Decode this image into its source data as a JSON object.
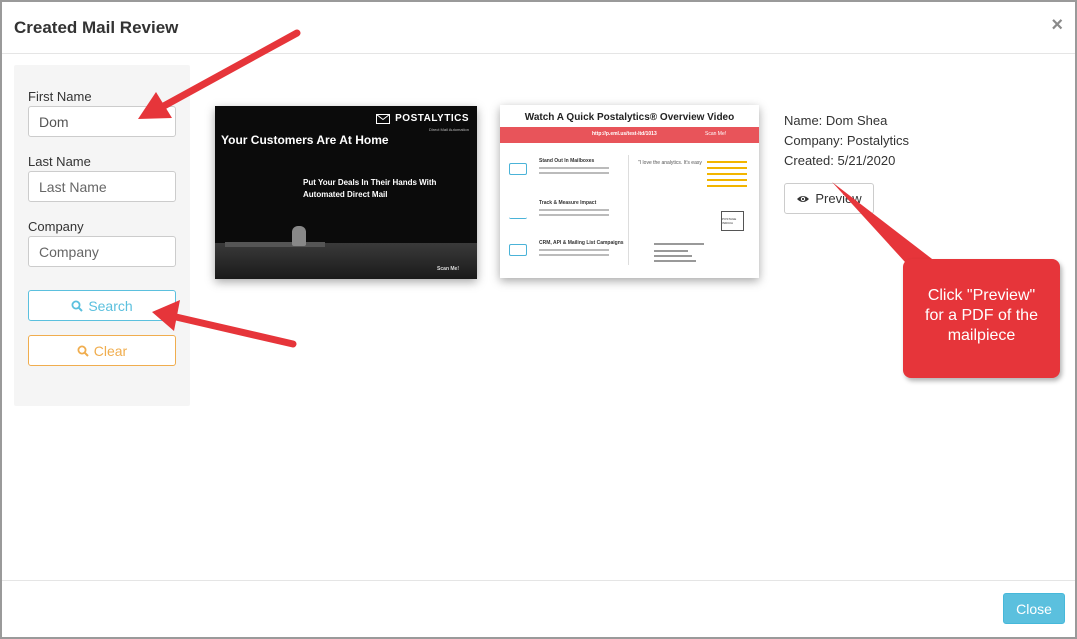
{
  "modal": {
    "title": "Created Mail Review",
    "close_glyph": "×"
  },
  "search": {
    "first_name_label": "First Name",
    "first_name_value": "Dom",
    "last_name_label": "Last Name",
    "last_name_placeholder": "Last Name",
    "company_label": "Company",
    "company_placeholder": "Company",
    "search_button_label": "Search",
    "clear_button_label": "Clear"
  },
  "mailpiece": {
    "front": {
      "brand": "POSTALYTICS",
      "brand_sub": "Direct Mail Automation",
      "headline": "Your Customers Are At Home",
      "sub_line_1": "Put Your Deals In Their Hands With",
      "sub_line_2": "Automated Direct Mail",
      "scan_label": "Scan Me!"
    },
    "back": {
      "title": "Watch A Quick Postalytics® Overview Video",
      "url": "http://p.eml.us/test-ltd/1013",
      "scan_label": "Scan Me!",
      "items": [
        {
          "title": "Stand Out In Mailboxes"
        },
        {
          "title": "Track & Measure Impact"
        },
        {
          "title": "CRM, API & Mailing List Campaigns"
        }
      ],
      "quote": "\"I love the analytics. It's easy",
      "stamp": "POSTAGE INDICIA"
    }
  },
  "details": {
    "name": "Name: Dom Shea",
    "company": "Company: Postalytics",
    "created": "Created: 5/21/2020",
    "preview_button_label": "Preview"
  },
  "annotation": {
    "callout_line_1": "Click \"Preview\"",
    "callout_line_2": "for a PDF of the",
    "callout_line_3": "mailpiece"
  },
  "footer": {
    "close_button_label": "Close"
  },
  "colors": {
    "info": "#5bc0de",
    "warning": "#f0ad4e",
    "callout_red": "#e6353a",
    "postcard_band": "#e8545a"
  }
}
